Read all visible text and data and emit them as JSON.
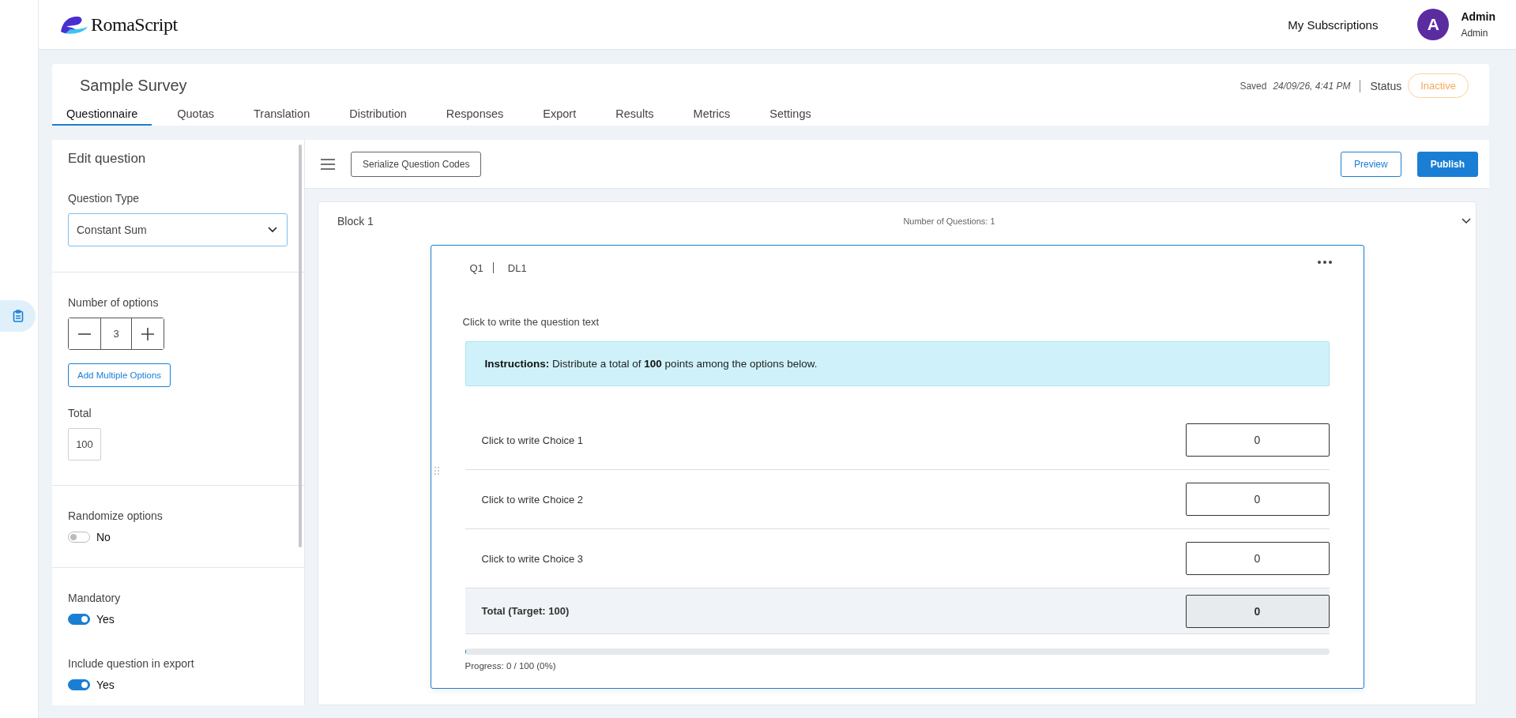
{
  "header": {
    "logo": "RomaScript",
    "links": [
      "My Subscriptions"
    ],
    "user": {
      "initial": "A",
      "name": "Admin",
      "role": "Admin"
    }
  },
  "rail": {
    "items": [
      {
        "selected": true
      }
    ]
  },
  "survey": {
    "title": "Sample Survey",
    "saved_label": "Saved",
    "saved_time": "24/09/26, 4:41 PM",
    "status_label": "Status",
    "status": "Inactive"
  },
  "tabs": [
    {
      "label": "Questionnaire",
      "selected": true
    },
    {
      "label": "Quotas",
      "selected": false
    },
    {
      "label": "Translation",
      "selected": false
    },
    {
      "label": "Distribution",
      "selected": false
    },
    {
      "label": "Responses",
      "selected": false
    },
    {
      "label": "Export",
      "selected": false
    },
    {
      "label": "Results",
      "selected": false
    },
    {
      "label": "Metrics",
      "selected": false
    },
    {
      "label": "Settings",
      "selected": false
    }
  ],
  "editor": {
    "title": "Edit question",
    "question_type": {
      "label": "Question Type",
      "value": "Constant Sum"
    },
    "options": {
      "label": "Number of options",
      "value": "3",
      "add_button": "Add Multiple Options"
    },
    "total": {
      "label": "Total",
      "value": "100"
    },
    "toggles": [
      {
        "label": "Randomize options",
        "on": false,
        "state_text": "No"
      },
      {
        "label": "Mandatory",
        "on": true,
        "state_text": "Yes"
      },
      {
        "label": "Include question in export",
        "on": true,
        "state_text": "Yes"
      }
    ]
  },
  "toolbar": {
    "serialize_button": "Serialize Question Codes",
    "buttons": [
      {
        "label": "Preview",
        "kind": "outline"
      },
      {
        "label": "Publish",
        "kind": "primary"
      }
    ]
  },
  "block": {
    "title": "Block 1",
    "count": "Number of Questions: 1",
    "expanded": true,
    "question": {
      "code": "Q1",
      "tag": "DL1",
      "text": "Click to write the question text",
      "instructions": "**Instructions:** Distribute a total of **100** points among the options below.",
      "choices": [
        {
          "label": "Click to write Choice 1",
          "value": "0"
        },
        {
          "label": "Click to write Choice 2",
          "value": "0"
        },
        {
          "label": "Click to write Choice 3",
          "value": "0"
        }
      ],
      "total": {
        "label": "Total (Target: 100)",
        "value": "0"
      },
      "progress": {
        "level": 0,
        "text": "Progress: 0 / 100 (0%)"
      }
    }
  }
}
